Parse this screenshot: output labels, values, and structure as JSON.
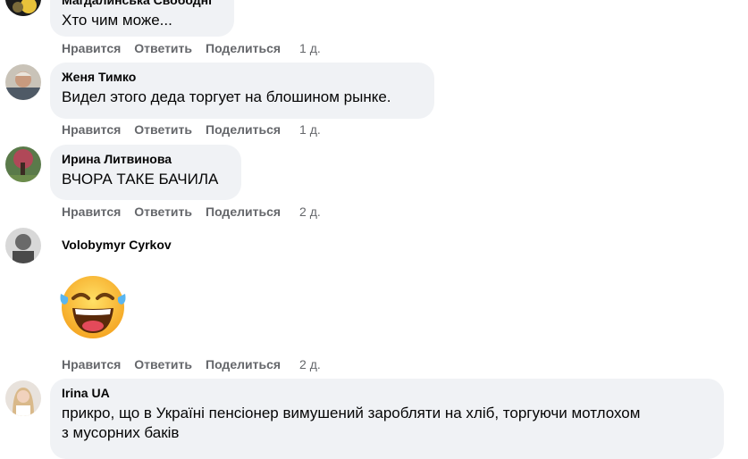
{
  "comments": [
    {
      "author": "Магдалинська Свободні",
      "text": "Хто чим може...",
      "time": "1 д."
    },
    {
      "author": "Женя Тимко",
      "text": "Видел этого деда торгует на блошином рынке.",
      "time": "1 д."
    },
    {
      "author": "Ирина Литвинова",
      "text": "ВЧОРА ТАКЕ БАЧИЛА",
      "time": "2 д."
    },
    {
      "author": "Volobymyr Cyrkov",
      "text": "",
      "time": "2 д."
    },
    {
      "author": "Irina UA",
      "text": "прикро, що в Україні пенсіонер вимушений заробляти на хліб, торгуючи мотлохом",
      "text2": "з мусорних баків",
      "time": ""
    }
  ],
  "actions": {
    "like": "Нравится",
    "reply": "Ответить",
    "share": "Поделиться"
  },
  "sticker": {
    "icon": "laughing-tears-emoji-icon"
  },
  "colors": {
    "bubble": "#f0f2f5",
    "action": "#65676b",
    "text": "#050505"
  }
}
